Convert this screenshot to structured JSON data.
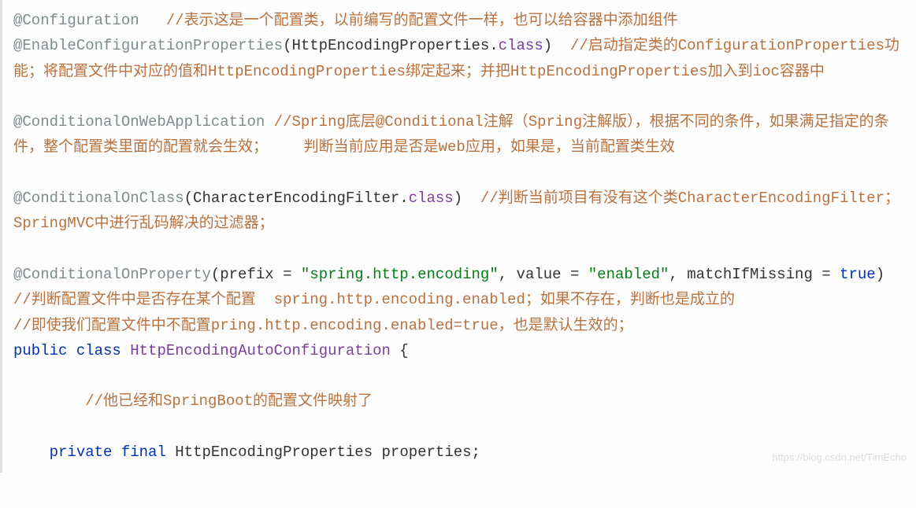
{
  "code": {
    "line1_annotation": "@Configuration",
    "line1_comment": "   //表示这是一个配置类，以前编写的配置文件一样，也可以给容器中添加组件",
    "line2_annotation": "@EnableConfigurationProperties",
    "line2_punct1": "(",
    "line2_class": "HttpEncodingProperties",
    "line2_punct2": ".",
    "line2_class2": "class",
    "line2_punct3": ")",
    "line2_comment": "  //启动指定类的ConfigurationProperties功能；将配置文件中对应的值和HttpEncodingProperties绑定起来；并把HttpEncodingProperties加入到ioc容器中",
    "line3_annotation": "@ConditionalOnWebApplication",
    "line3_comment": " //Spring底层@Conditional注解（Spring注解版），根据不同的条件，如果满足指定的条件，整个配置类里面的配置就会生效；    判断当前应用是否是web应用，如果是，当前配置类生效",
    "line4_annotation": "@ConditionalOnClass",
    "line4_punct1": "(",
    "line4_class": "CharacterEncodingFilter",
    "line4_punct2": ".",
    "line4_class2": "class",
    "line4_punct3": ")",
    "line4_comment": "  //判断当前项目有没有这个类CharacterEncodingFilter；SpringMVC中进行乱码解决的过滤器；",
    "line5_annotation": "@ConditionalOnProperty",
    "line5_punct1": "(",
    "line5_attr1": "prefix",
    "line5_eq1": " = ",
    "line5_str1": "\"spring.http.encoding\"",
    "line5_comma1": ", ",
    "line5_attr2": "value",
    "line5_eq2": " = ",
    "line5_str2": "\"enabled\"",
    "line5_comma2": ", ",
    "line5_attr3": "matchIfMissing",
    "line5_eq3": " = ",
    "line5_bool": "true",
    "line5_punct2": ")",
    "line5_comment": "  //判断配置文件中是否存在某个配置  spring.http.encoding.enabled；如果不存在，判断也是成立的",
    "line6_comment": "//即使我们配置文件中不配置pring.http.encoding.enabled=true，也是默认生效的；",
    "line7_kw1": "public",
    "line7_kw2": "class",
    "line7_class": "HttpEncodingAutoConfiguration",
    "line7_brace": " {",
    "line8_comment": "  \t//他已经和SpringBoot的配置文件映射了",
    "line9_kw1": "    private",
    "line9_kw2": "final",
    "line9_type": "HttpEncodingProperties",
    "line9_var": " properties;",
    "watermark": "https://blog.csdn.net/TimEcho"
  }
}
